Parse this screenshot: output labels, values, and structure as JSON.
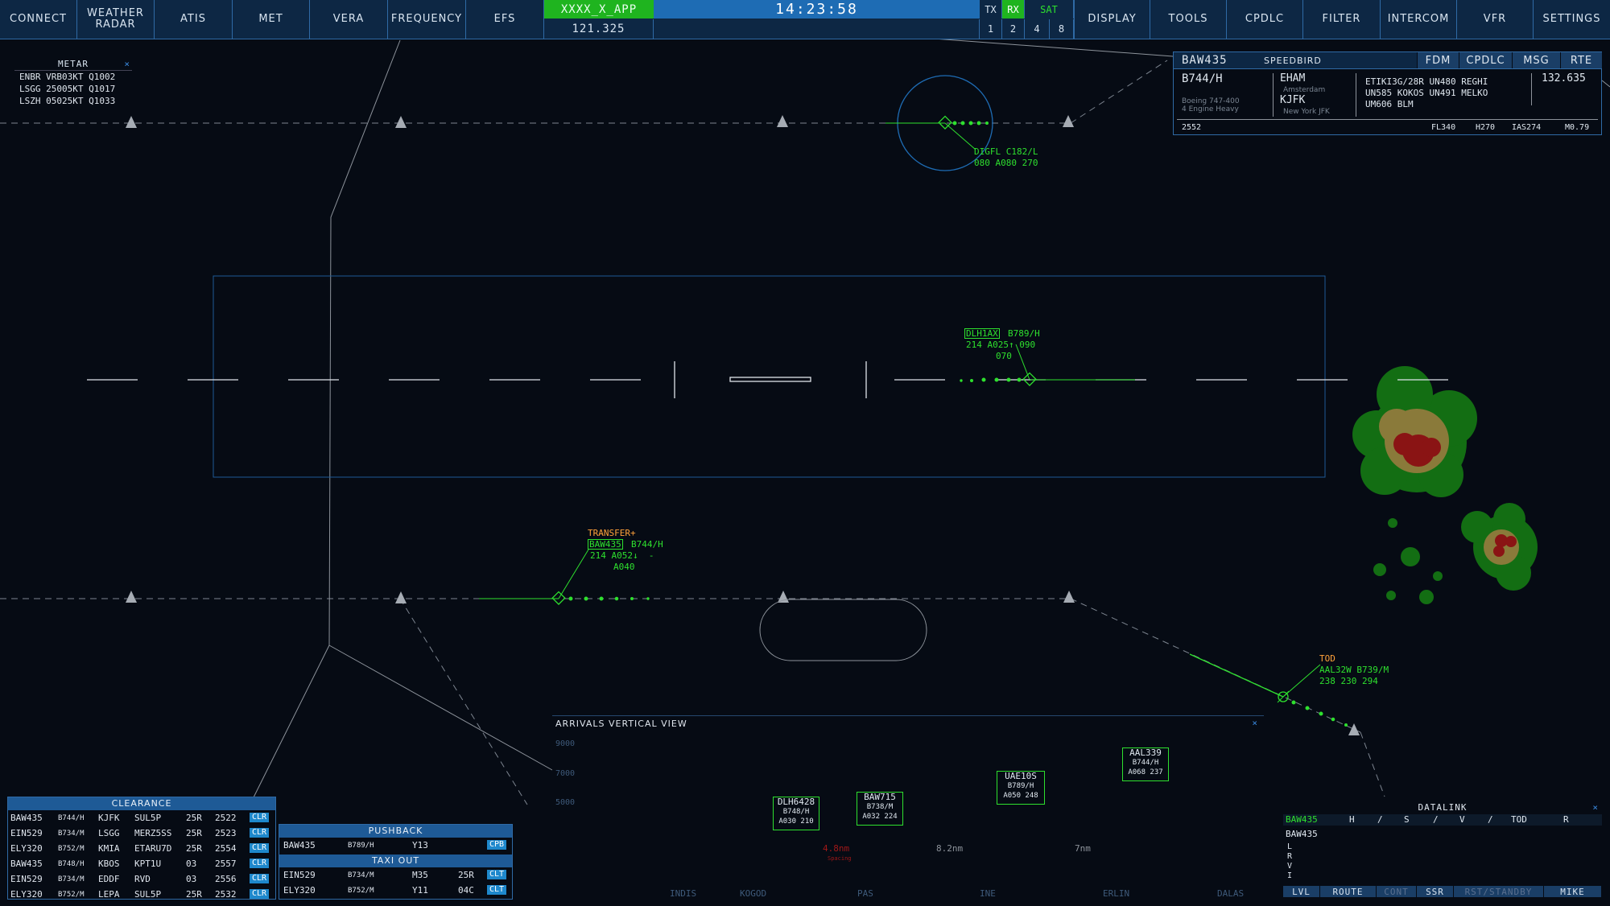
{
  "colors": {
    "background": "#060b14",
    "topbar": "#0d2744",
    "accent": "#1e6cb4",
    "station_active": "#1fb41f",
    "traffic_green": "#2ee02e",
    "transfer_orange": "#ffa23a",
    "weather_light": "#136e13",
    "weather_mid": "#8a7a3a",
    "weather_heavy": "#8a1414"
  },
  "topbar": {
    "left_buttons": [
      "CONNECT",
      "WEATHER\nRADAR",
      "ATIS",
      "MET",
      "VERA",
      "FREQUENCY",
      "EFS"
    ],
    "station": "XXXX_X_APP",
    "frequency": "121.325",
    "clock": "14:23:58",
    "tx": "TX",
    "rx": "RX",
    "sat": "SAT",
    "channels": [
      "1",
      "2",
      "4",
      "8"
    ],
    "right_buttons": [
      "DISPLAY",
      "TOOLS",
      "CPDLC",
      "FILTER",
      "INTERCOM",
      "VFR",
      "SETTINGS"
    ]
  },
  "metar": {
    "title": "METAR",
    "close": "×",
    "rows": [
      "ENBR VRB03KT Q1002",
      "LSGG 25005KT Q1017",
      "LSZH 05025KT Q1033"
    ]
  },
  "flightplan": {
    "callsign": "BAW435",
    "radio_callsign": "SPEEDBIRD",
    "tabs": [
      "FDM",
      "CPDLC",
      "MSG",
      "RTE"
    ],
    "type": "B744/H",
    "type_name": "Boeing 747-400",
    "type_desc": "4 Engine Heavy",
    "dep": "EHAM",
    "dep_name": "Amsterdam",
    "arr": "KJFK",
    "arr_name": "New York JFK",
    "route": [
      "ETIKI3G/28R UN480 REGHI",
      "UN585 KOKOS UN491 MELKO",
      "UM606 BLM"
    ],
    "freq": "132.635",
    "squawk": "2552",
    "fl": "FL340",
    "hdg": "H270",
    "ias": "IAS274",
    "mach": "M0.79"
  },
  "labels": {
    "digfl": {
      "l1": "DIGFL C182/L",
      "l2": "080 A080 270"
    },
    "dlh1ax": {
      "cs": "DLH1AX",
      "type": "B789/H",
      "l2": "214 A025↑ 090",
      "l3": "070"
    },
    "baw435": {
      "status": "TRANSFER+",
      "cs": "BAW435",
      "type": "B744/H",
      "l2": "214 A052↓  -",
      "l3": "A040"
    },
    "aal32w": {
      "status": "TOD",
      "l1": "AAL32W B739/M",
      "l2": "238 230 294"
    }
  },
  "vertical_view": {
    "title": "ARRIVALS VERTICAL VIEW",
    "close": "×",
    "alt_labels": [
      "9000",
      "7000",
      "5000"
    ],
    "fixes": [
      "INDIS",
      "KOGOD",
      "PAS",
      "INE",
      "ERLIN",
      "DALAS"
    ],
    "spacing": [
      {
        "value": "4.8nm",
        "note": "Spacing"
      },
      {
        "value": "8.2nm",
        "note": ""
      },
      {
        "value": "7nm",
        "note": ""
      }
    ],
    "aircraft": [
      {
        "cs": "DLH6428",
        "type": "B748/H",
        "data": "A030 210"
      },
      {
        "cs": "BAW715",
        "type": "B738/M",
        "data": "A032 224"
      },
      {
        "cs": "UAE10S",
        "type": "B789/H",
        "data": "A050 248"
      },
      {
        "cs": "AAL339",
        "type": "B744/H",
        "data": "A068 237"
      }
    ]
  },
  "clearance": {
    "title": "CLEARANCE",
    "rows": [
      {
        "cs": "BAW435",
        "type": "B744/H",
        "dest": "KJFK",
        "sid": "SUL5P",
        "rwy": "25R",
        "sq": "2522",
        "btn": "CLR"
      },
      {
        "cs": "EIN529",
        "type": "B734/M",
        "dest": "LSGG",
        "sid": "MERZ5SS",
        "rwy": "25R",
        "sq": "2523",
        "btn": "CLR"
      },
      {
        "cs": "ELY320",
        "type": "B752/M",
        "dest": "KMIA",
        "sid": "ETARU7D",
        "rwy": "25R",
        "sq": "2554",
        "btn": "CLR"
      },
      {
        "cs": "BAW435",
        "type": "B748/H",
        "dest": "KBOS",
        "sid": "KPT1U",
        "rwy": "03",
        "sq": "2557",
        "btn": "CLR"
      },
      {
        "cs": "EIN529",
        "type": "B734/M",
        "dest": "EDDF",
        "sid": "RVD",
        "rwy": "03",
        "sq": "2556",
        "btn": "CLR"
      },
      {
        "cs": "ELY320",
        "type": "B752/M",
        "dest": "LEPA",
        "sid": "SUL5P",
        "rwy": "25R",
        "sq": "2532",
        "btn": "CLR"
      }
    ]
  },
  "pushback": {
    "title": "PUSHBACK",
    "rows": [
      {
        "cs": "BAW435",
        "type": "B789/H",
        "stand": "Y13",
        "btn": "CPB"
      }
    ]
  },
  "taxiout": {
    "title": "TAXI OUT",
    "rows": [
      {
        "cs": "EIN529",
        "type": "B734/M",
        "twy": "M35",
        "rwy": "25R",
        "btn": "CLT"
      },
      {
        "cs": "ELY320",
        "type": "B752/M",
        "twy": "Y11",
        "rwy": "04C",
        "btn": "CLT"
      }
    ]
  },
  "datalink": {
    "title": "DATALINK",
    "close": "×",
    "header": [
      "BAW435",
      "H",
      "/",
      "S",
      "/",
      "V",
      "/",
      "TOD",
      "R"
    ],
    "callsign": "BAW435",
    "letters": [
      "L",
      "R",
      "V",
      "I"
    ],
    "buttons": [
      "LVL",
      "ROUTE",
      "CONT",
      "SSR",
      "RST/STANDBY",
      "MIKE"
    ]
  }
}
